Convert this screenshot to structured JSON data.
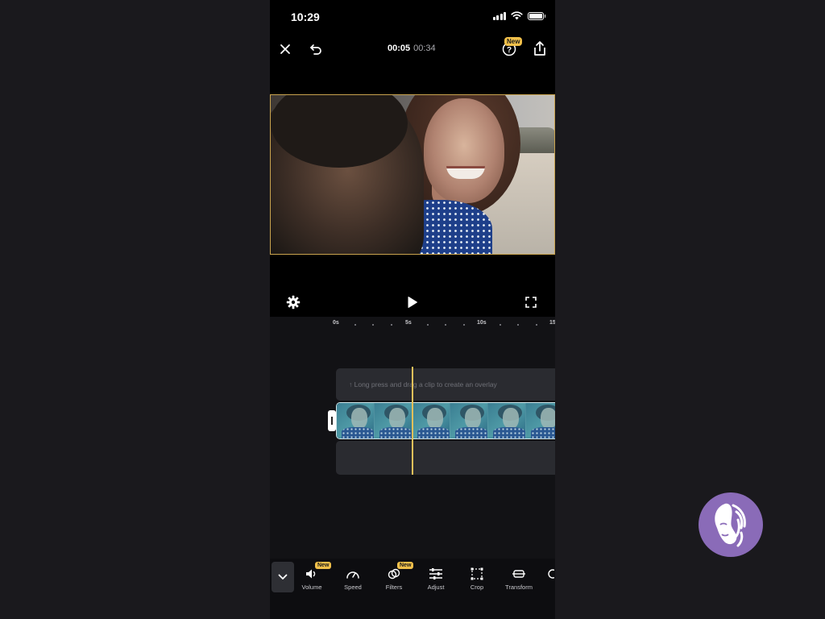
{
  "status_bar": {
    "time": "10:29"
  },
  "header": {
    "current_time": "00:05",
    "total_time": "00:34",
    "help_badge": "New"
  },
  "timeline": {
    "ruler_labels": [
      "0s",
      "5s",
      "10s",
      "15"
    ],
    "overlay_hint": "↑ Long press and drag a clip to create an overlay",
    "accent_color": "#e8c15a"
  },
  "toolbar": {
    "items": [
      {
        "label": "Volume",
        "icon": "volume-icon",
        "badge": "New"
      },
      {
        "label": "Speed",
        "icon": "speed-icon"
      },
      {
        "label": "Filters",
        "icon": "filters-icon",
        "badge": "New"
      },
      {
        "label": "Adjust",
        "icon": "adjust-icon"
      },
      {
        "label": "Crop",
        "icon": "crop-icon"
      },
      {
        "label": "Transform",
        "icon": "transform-icon"
      }
    ]
  },
  "colors": {
    "badge": "#f1c04a",
    "preview_border": "#c9a34e",
    "clip_border": "#cfe6ea"
  }
}
